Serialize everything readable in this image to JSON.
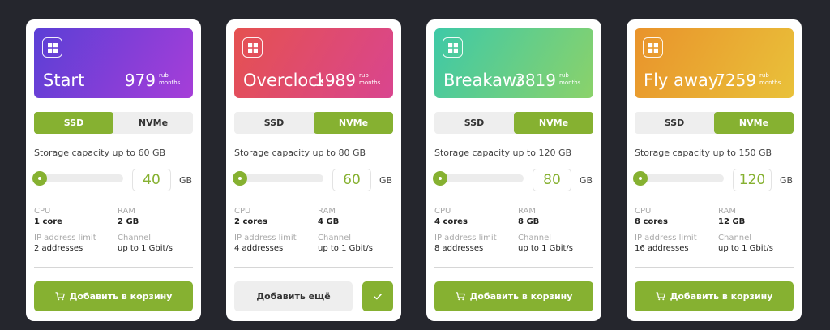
{
  "labels": {
    "cpu": "CPU",
    "ram": "RAM",
    "ip": "IP address limit",
    "channel": "Channel",
    "gb": "GB",
    "add_to_cart": "Добавить в корзину",
    "add_more": "Добавить ещё"
  },
  "plans": [
    {
      "name": "Start",
      "price": "979",
      "unit_top": "rub",
      "unit_bottom": "months",
      "gradient": [
        "#5b3fd6",
        "#a63ed8"
      ],
      "storage_options": [
        "SSD",
        "NVMe"
      ],
      "selected_storage": "SSD",
      "capacity_text": "Storage capacity up to 60 GB",
      "storage_value": "40",
      "cpu": "1 core",
      "ram": "2 GB",
      "ip_limit": "2 addresses",
      "channel": "up to 1 Gbit/s",
      "in_cart": false
    },
    {
      "name": "Overclocking",
      "price": "1989",
      "unit_top": "rub",
      "unit_bottom": "months",
      "gradient": [
        "#e55150",
        "#d9458f"
      ],
      "storage_options": [
        "SSD",
        "NVMe"
      ],
      "selected_storage": "NVMe",
      "capacity_text": "Storage capacity up to 80 GB",
      "storage_value": "60",
      "cpu": "2 cores",
      "ram": "4 GB",
      "ip_limit": "4 addresses",
      "channel": "up to 1 Gbit/s",
      "in_cart": true
    },
    {
      "name": "Breakaway",
      "price": "3819",
      "unit_top": "rub",
      "unit_bottom": "months",
      "gradient": [
        "#3ec9a7",
        "#8bd26a"
      ],
      "storage_options": [
        "SSD",
        "NVMe"
      ],
      "selected_storage": "NVMe",
      "capacity_text": "Storage capacity up to 120 GB",
      "storage_value": "80",
      "cpu": "4 cores",
      "ram": "8 GB",
      "ip_limit": "8 addresses",
      "channel": "up to 1 Gbit/s",
      "in_cart": false
    },
    {
      "name": "Fly away",
      "price": "7259",
      "unit_top": "rub",
      "unit_bottom": "months",
      "gradient": [
        "#e9932b",
        "#e9c13a"
      ],
      "storage_options": [
        "SSD",
        "NVMe"
      ],
      "selected_storage": "NVMe",
      "capacity_text": "Storage capacity up to 150 GB",
      "storage_value": "120",
      "cpu": "8 cores",
      "ram": "12 GB",
      "ip_limit": "16 addresses",
      "channel": "up to 1 Gbit/s",
      "in_cart": false
    }
  ],
  "colors": {
    "accent": "#86b131",
    "background": "#25262d"
  },
  "icons": {
    "windows": "windows-icon",
    "cart": "cart-icon",
    "check": "check-icon"
  }
}
